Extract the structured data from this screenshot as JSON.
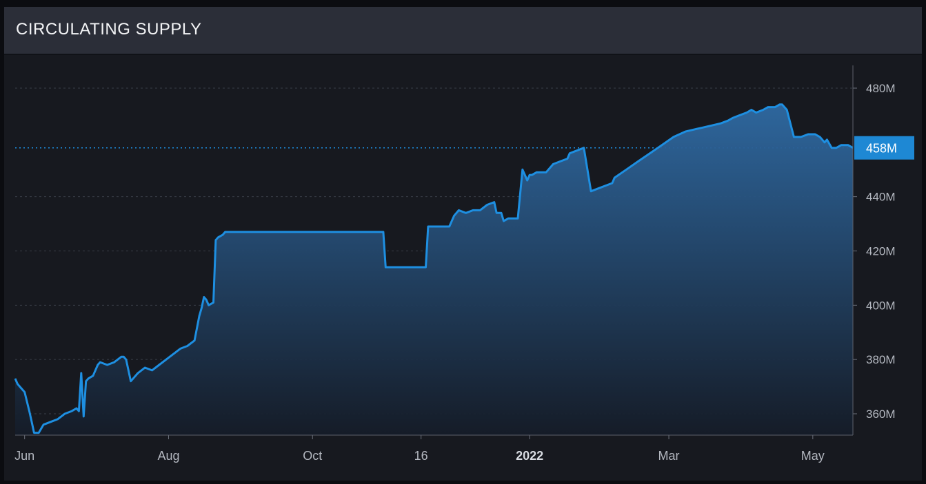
{
  "header": {
    "title": "CIRCULATING SUPPLY"
  },
  "chart_data": {
    "type": "area",
    "title": "CIRCULATING SUPPLY",
    "xlabel": "",
    "ylabel": "",
    "x_ticks": [
      "Jun",
      "Aug",
      "Oct",
      "16",
      "2022",
      "Mar",
      "May"
    ],
    "y_ticks": [
      "360M",
      "380M",
      "400M",
      "420M",
      "440M",
      "480M"
    ],
    "ylim": [
      352,
      490
    ],
    "current_value_label": "458M",
    "current_value": 458,
    "grid": true,
    "colors": {
      "line": "#1e8fe1",
      "fill_top": "#2f6aa3",
      "fill_bottom": "#151c28",
      "badge": "#1e88d4"
    },
    "series": [
      {
        "x": [
          "2021-05-28",
          "2021-05-29",
          "2021-05-30",
          "2021-06-01",
          "2021-06-03",
          "2021-06-04",
          "2021-06-05",
          "2021-06-07",
          "2021-06-09",
          "2021-06-12",
          "2021-06-15",
          "2021-06-18",
          "2021-06-21",
          "2021-06-23",
          "2021-06-24",
          "2021-06-25",
          "2021-06-26",
          "2021-06-27",
          "2021-06-28",
          "2021-06-30",
          "2021-07-02",
          "2021-07-03",
          "2021-07-06",
          "2021-07-09",
          "2021-07-12",
          "2021-07-13",
          "2021-07-14",
          "2021-07-16",
          "2021-07-19",
          "2021-07-22",
          "2021-07-25",
          "2021-07-28",
          "2021-07-31",
          "2021-08-03",
          "2021-08-06",
          "2021-08-09",
          "2021-08-12",
          "2021-08-14",
          "2021-08-15",
          "2021-08-16",
          "2021-08-17",
          "2021-08-18",
          "2021-08-20",
          "2021-08-21",
          "2021-08-22",
          "2021-08-24",
          "2021-08-25",
          "2021-08-28",
          "2021-09-04",
          "2021-09-20",
          "2021-10-05",
          "2021-10-20",
          "2021-10-31",
          "2021-11-01",
          "2021-11-08",
          "2021-11-15",
          "2021-11-18",
          "2021-11-19",
          "2021-11-21",
          "2021-11-28",
          "2021-11-30",
          "2021-12-02",
          "2021-12-05",
          "2021-12-08",
          "2021-12-11",
          "2021-12-14",
          "2021-12-17",
          "2021-12-18",
          "2021-12-20",
          "2021-12-21",
          "2021-12-23",
          "2021-12-25",
          "2021-12-27",
          "2021-12-29",
          "2021-12-31",
          "2022-01-01",
          "2022-01-02",
          "2022-01-04",
          "2022-01-06",
          "2022-01-08",
          "2022-01-11",
          "2022-01-14",
          "2022-01-17",
          "2022-01-18",
          "2022-01-21",
          "2022-01-24",
          "2022-01-27",
          "2022-01-30",
          "2022-02-05",
          "2022-02-06",
          "2022-02-11",
          "2022-02-16",
          "2022-02-21",
          "2022-02-26",
          "2022-03-03",
          "2022-03-08",
          "2022-03-13",
          "2022-03-18",
          "2022-03-23",
          "2022-03-26",
          "2022-03-28",
          "2022-03-31",
          "2022-04-03",
          "2022-04-05",
          "2022-04-07",
          "2022-04-10",
          "2022-04-12",
          "2022-04-15",
          "2022-04-17",
          "2022-04-18",
          "2022-04-20",
          "2022-04-23",
          "2022-04-26",
          "2022-04-29",
          "2022-05-02",
          "2022-05-04",
          "2022-05-06",
          "2022-05-07",
          "2022-05-09",
          "2022-05-11",
          "2022-05-13",
          "2022-05-16",
          "2022-05-18"
        ],
        "values": [
          373,
          371,
          370,
          368,
          361,
          357,
          353,
          353,
          356,
          357,
          358,
          360,
          361,
          362,
          361,
          375,
          359,
          372,
          373,
          374,
          378,
          379,
          378,
          379,
          381,
          381,
          380,
          372,
          375,
          377,
          376,
          378,
          380,
          382,
          384,
          385,
          387,
          396,
          399,
          403,
          402,
          400,
          401,
          424,
          425,
          426,
          427,
          427,
          427,
          427,
          427,
          427,
          427,
          414,
          414,
          414,
          414,
          429,
          429,
          429,
          433,
          435,
          434,
          435,
          435,
          437,
          438,
          434,
          434,
          431,
          432,
          432,
          432,
          450,
          446,
          448,
          448,
          449,
          449,
          449,
          452,
          453,
          454,
          456,
          457,
          458,
          442,
          443,
          445,
          447,
          450,
          453,
          456,
          459,
          462,
          464,
          465,
          466,
          467,
          468,
          469,
          470,
          471,
          472,
          471,
          472,
          473,
          473,
          474,
          474,
          472,
          462,
          462,
          463,
          463,
          462,
          460,
          461,
          458,
          458,
          459,
          459,
          458
        ]
      }
    ]
  }
}
